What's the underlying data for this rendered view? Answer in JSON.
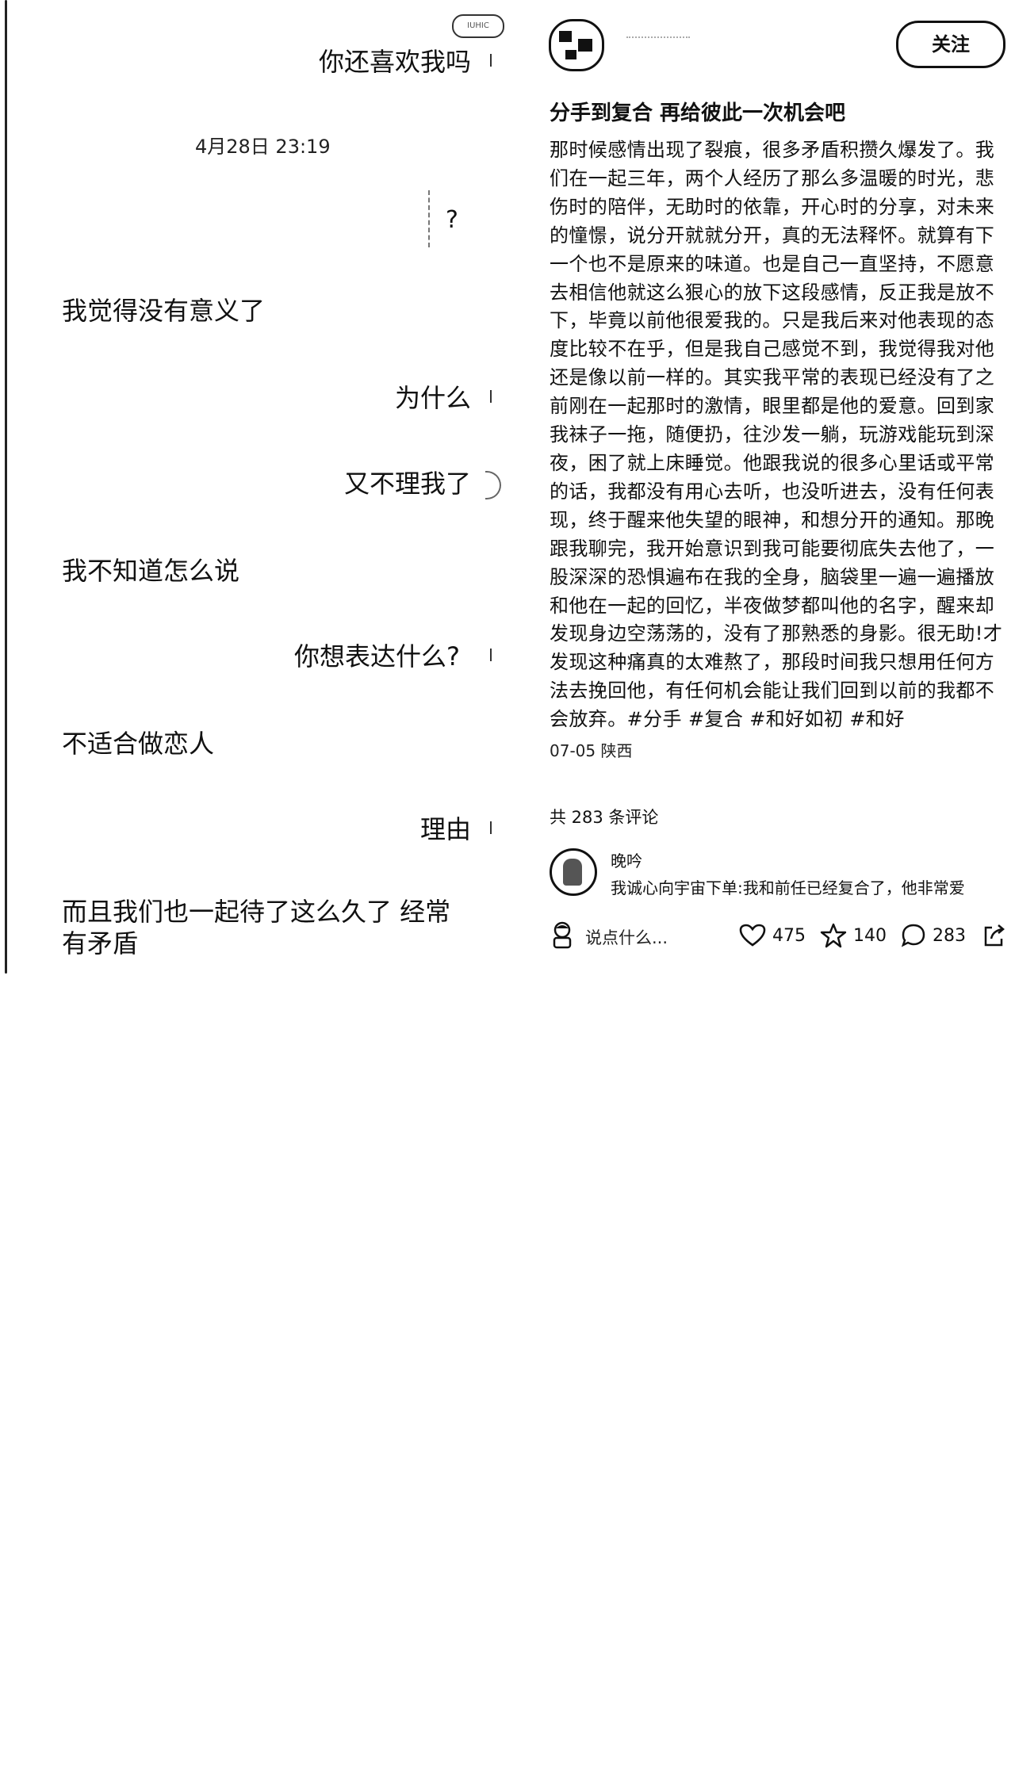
{
  "chat": {
    "top_pill": "IUHIC",
    "messages": [
      {
        "side": "right",
        "text": "你还喜欢我吗"
      },
      {
        "side": "left",
        "text": "我觉得没有意义了"
      },
      {
        "side": "right",
        "text": "为什么"
      },
      {
        "side": "right",
        "text": "又不理我了"
      },
      {
        "side": "left",
        "text": "我不知道怎么说"
      },
      {
        "side": "right",
        "text": "你想表达什么?"
      },
      {
        "side": "left",
        "text": "不适合做恋人"
      },
      {
        "side": "right",
        "text": "理由"
      },
      {
        "side": "left",
        "text": "而且我们也一起待了这么久了 经常有矛盾"
      }
    ],
    "timestamp": "4月28日 23:19",
    "question_mark": "?"
  },
  "post": {
    "follow_label": "关注",
    "title": "分手到复合 再给彼此一次机会吧",
    "body": "那时候感情出现了裂痕，很多矛盾积攒久爆发了。我们在一起三年，两个人经历了那么多温暖的时光，悲伤时的陪伴，无助时的依靠，开心时的分享，对未来的憧憬，说分开就就分开，真的无法释怀。就算有下一个也不是原来的味道。也是自己一直坚持，不愿意去相信他就这么狠心的放下这段感情，反正我是放不下，毕竟以前他很爱我的。只是我后来对他表现的态度比较不在乎，但是我自己感觉不到，我觉得我对他还是像以前一样的。其实我平常的表现已经没有了之前刚在一起那时的激情，眼里都是他的爱意。回到家我袜子一拖，随便扔，往沙发一躺，玩游戏能玩到深夜，困了就上床睡觉。他跟我说的很多心里话或平常的话，我都没有用心去听，也没听进去，没有任何表现，终于醒来他失望的眼神，和想分开的通知。那晚跟我聊完，我开始意识到我可能要彻底失去他了，一股深深的恐惧遍布在我的全身，脑袋里一遍一遍播放和他在一起的回忆，半夜做梦都叫他的名字，醒来却发现身边空荡荡的，没有了那熟悉的身影。很无助!才发现这种痛真的太难熬了，那段时间我只想用任何方法去挽回他，有任何机会能让我们回到以前的我都不会放弃。#分手 #复合 #和好如初 #和好",
    "meta": "07-05 陕西",
    "comment_count": "共 283 条评论",
    "top_comment": {
      "name": "晚吟",
      "text": "我诚心向宇宙下单:我和前任已经复合了，他非常爱"
    },
    "bottom_bar": {
      "input_placeholder": "说点什么...",
      "likes": "475",
      "stars": "140",
      "comments": "283"
    }
  }
}
